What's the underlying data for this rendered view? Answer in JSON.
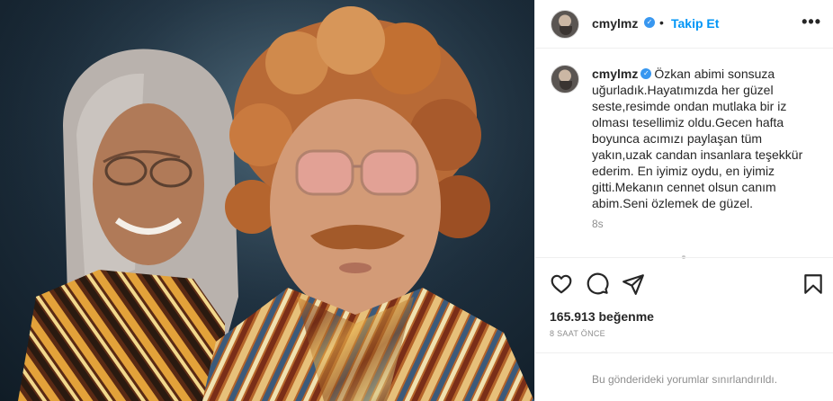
{
  "post": {
    "username": "cmylmz",
    "follow_label": "Takip Et",
    "separator": "•",
    "more_label": "•••",
    "verified_mark": "✓",
    "caption": "Özkan abimi sonsuza uğurladık.Hayatımızda her güzel seste,resimde ondan mutlaka bir iz olması tesellimiz oldu.Gecen hafta boyunca acımızı paylaşan tüm yakın,uzak candan insanlara teşekkür ederim. En iyimiz oydu, en iyimiz gitti.Mekanın cennet olsun canım abim.Seni özlemek de güzel.",
    "caption_age": "8s",
    "likes": "165.913 beğenme",
    "post_time": "8 SAAT ÖNCE",
    "comments_limited": "Bu gönderideki yorumlar sınırlandırıldı."
  },
  "icons": {
    "like": "heart-icon",
    "comment": "comment-icon",
    "share": "share-icon",
    "save": "bookmark-icon"
  },
  "colors": {
    "accent": "#0095f6",
    "verified": "#3897f0",
    "text": "#262626",
    "muted": "#8e8e8e",
    "border": "#efefef"
  }
}
